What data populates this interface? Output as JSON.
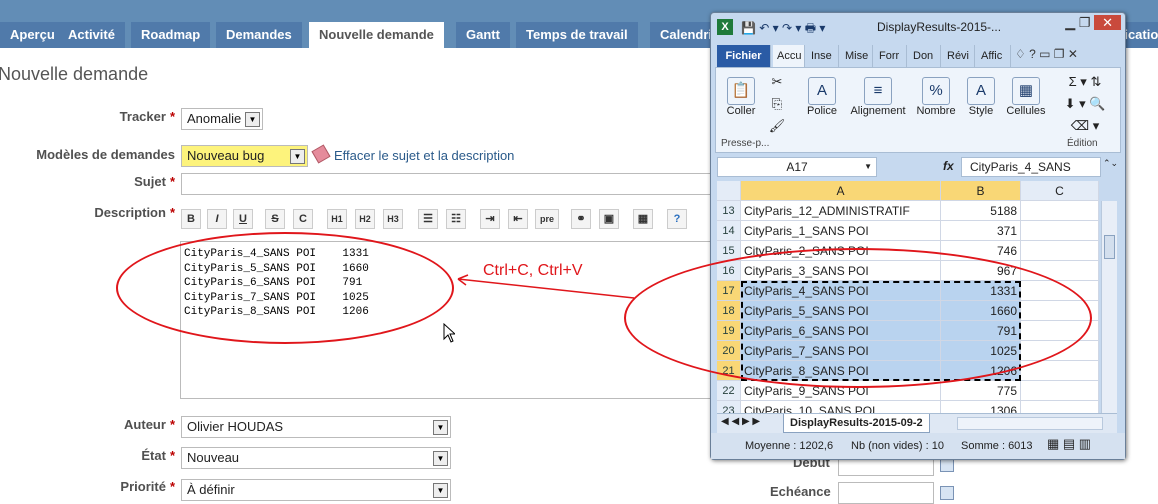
{
  "tabs": [
    "Aperçu",
    "Activité",
    "Roadmap",
    "Demandes",
    "Nouvelle demande",
    "Gantt",
    "Temps de travail",
    "Calendrier",
    "fication"
  ],
  "page_title": "Nouvelle demande",
  "form": {
    "tracker_label": "Tracker",
    "tracker_value": "Anomalie",
    "templates_label": "Modèles de demandes",
    "templates_value": "Nouveau bug",
    "clear_link": "Effacer le sujet et la description",
    "subject_label": "Sujet",
    "description_label": "Description",
    "description_value": "CityParis_4_SANS POI    1331\nCityParis_5_SANS POI    1660\nCityParis_6_SANS POI    791\nCityParis_7_SANS POI    1025\nCityParis_8_SANS POI    1206",
    "author_label": "Auteur",
    "author_value": "Olivier HOUDAS",
    "state_label": "État",
    "state_value": "Nouveau",
    "priority_label": "Priorité",
    "priority_value": "À définir",
    "start_label": "Début",
    "due_label": "Echéance",
    "required_mark": "*"
  },
  "toolbar": [
    "B",
    "I",
    "U",
    "S",
    "C",
    "H1",
    "H2",
    "H3",
    "ul",
    "ol",
    "in",
    "out",
    "pre",
    "lk",
    "img",
    "tbl",
    "?"
  ],
  "annotation": "Ctrl+C, Ctrl+V",
  "excel": {
    "title": "DisplayResults-2015-...",
    "ribbon_tabs": [
      "Fichier",
      "Accu",
      "Inse",
      "Mise",
      "Forr",
      "Don",
      "Révi",
      "Affic"
    ],
    "groups": {
      "police": "Police",
      "alignement": "Alignement",
      "nombre": "Nombre",
      "style": "Style",
      "cellules": "Cellules",
      "presse": "Presse-p...",
      "coller": "Coller",
      "edition": "Édition"
    },
    "name_box": "A17",
    "fx": "fx",
    "formula": "CityParis_4_SANS",
    "col_headers": [
      "A",
      "B",
      "C"
    ],
    "rows": [
      {
        "n": "13",
        "a": "CityParis_12_ADMINISTRATIF",
        "b": "5188"
      },
      {
        "n": "14",
        "a": "CityParis_1_SANS POI",
        "b": "371"
      },
      {
        "n": "15",
        "a": "CityParis_2_SANS POI",
        "b": "746"
      },
      {
        "n": "16",
        "a": "CityParis_3_SANS POI",
        "b": "967"
      },
      {
        "n": "17",
        "a": "CityParis_4_SANS POI",
        "b": "1331"
      },
      {
        "n": "18",
        "a": "CityParis_5_SANS POI",
        "b": "1660"
      },
      {
        "n": "19",
        "a": "CityParis_6_SANS POI",
        "b": "791"
      },
      {
        "n": "20",
        "a": "CityParis_7_SANS POI",
        "b": "1025"
      },
      {
        "n": "21",
        "a": "CityParis_8_SANS POI",
        "b": "1206"
      },
      {
        "n": "22",
        "a": "CityParis_9_SANS POI",
        "b": "775"
      },
      {
        "n": "23",
        "a": "CityParis_10_SANS POI",
        "b": "1306"
      }
    ],
    "sheet_tab": "DisplayResults-2015-09-2",
    "status": {
      "avg": "Moyenne : 1202,6",
      "count": "Nb (non vides) : 10",
      "sum": "Somme : 6013"
    }
  },
  "colors": {
    "accent": "#628db6",
    "annotation": "#e0161b",
    "selection": "#b9d3ef"
  }
}
